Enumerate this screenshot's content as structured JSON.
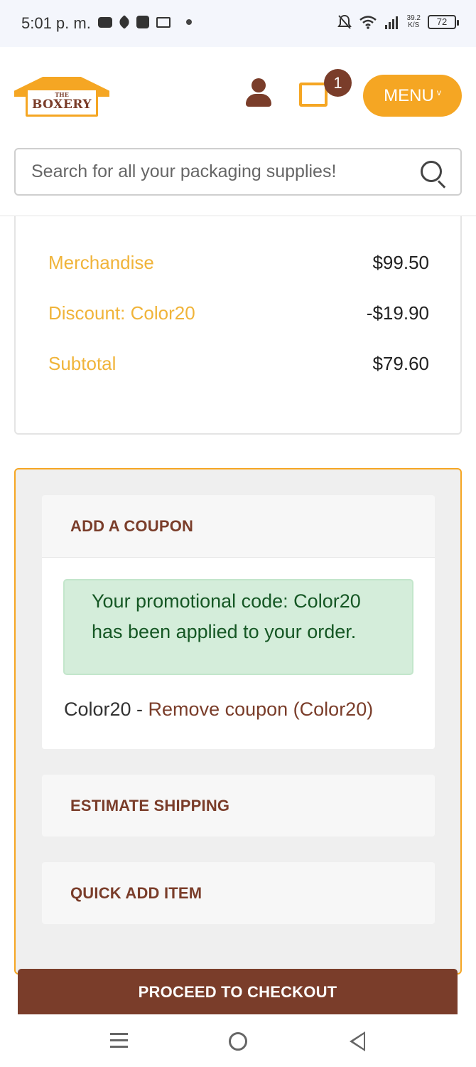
{
  "status_bar": {
    "time": "5:01 p. m.",
    "net_speed_value": "39.2",
    "net_speed_unit": "K/S",
    "battery": "72",
    "left_icons": [
      "youtube-icon",
      "rocket-icon",
      "news-icon",
      "gmail-icon",
      "dot-icon"
    ],
    "right_icons": [
      "bell-off-icon",
      "wifi-icon",
      "signal-icon",
      "battery-icon"
    ]
  },
  "header": {
    "logo_top": "THE",
    "logo_name": "BOXERY",
    "cart_count": "1",
    "menu_label": "MENU",
    "menu_caret": "v",
    "search_placeholder": "Search for all your packaging supplies!"
  },
  "totals": {
    "rows": [
      {
        "label": "Merchandise",
        "value": "$99.50"
      },
      {
        "label": "Discount: Color20",
        "value": "-$19.90"
      },
      {
        "label": "Subtotal",
        "value": "$79.60"
      }
    ]
  },
  "cart_actions": {
    "coupon_header": "ADD A COUPON",
    "coupon_alert": "Your promotional code: Color20 has been applied to your order.",
    "coupon_code": "Color20 - ",
    "coupon_remove": "Remove coupon (Color20)",
    "shipping_header": "ESTIMATE SHIPPING",
    "quick_add_header": "QUICK ADD ITEM"
  },
  "checkout_label": "PROCEED TO CHECKOUT",
  "colors": {
    "brand_orange": "#f5a623",
    "brand_brown": "#7a3d2a",
    "success_bg": "#d4edda",
    "success_text": "#155724"
  }
}
